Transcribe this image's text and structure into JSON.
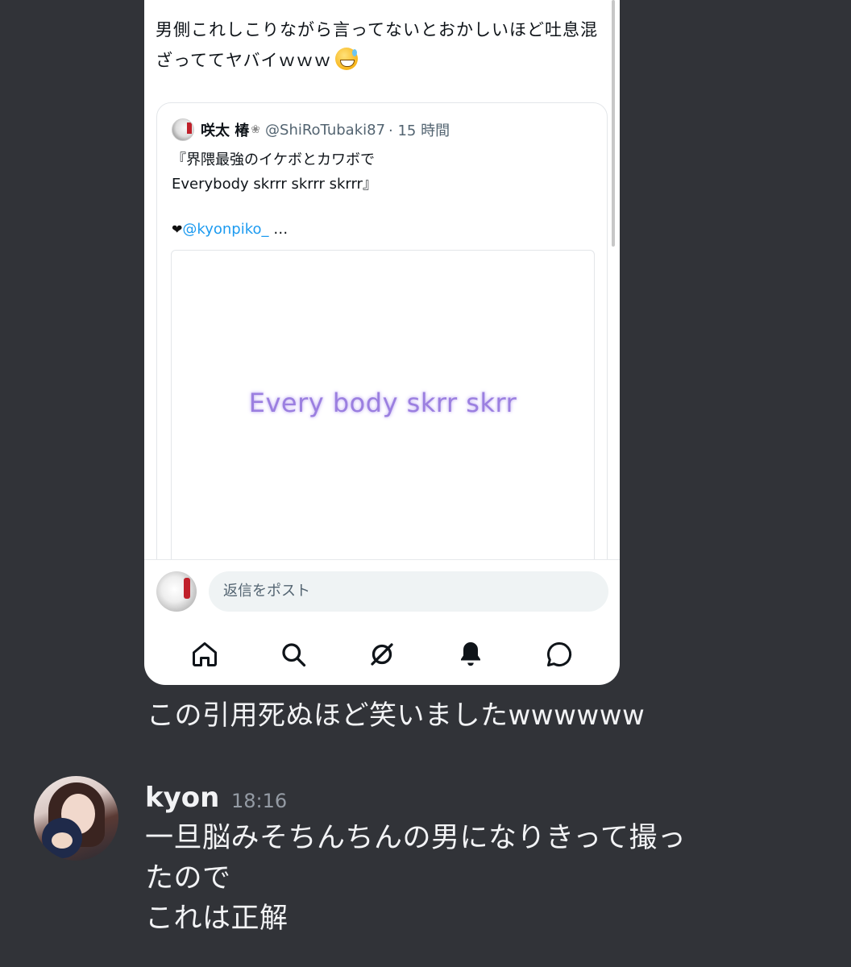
{
  "quoted_screenshot": {
    "tweet_text": "男側これしこりながら言ってないとおかしいほど吐息混ざっててヤバイｗｗｗ",
    "tweet_emoji": "sweat-smile-emoji",
    "quote": {
      "author_name": "咲太 椿",
      "author_flower": "❀",
      "author_handle": "@ShiRoTubaki87",
      "time": "· 15 時間",
      "body": "『界隈最強のイケボとカワボで\nEverybody skrrr skrrr skrrr』",
      "mention": "@kyonpiko_",
      "mention_suffix": " …",
      "media_caption": "Every body skrr skrr"
    },
    "reply_placeholder": "返信をポスト",
    "tabs": [
      "home-icon",
      "search-icon",
      "grok-icon",
      "notifications-icon",
      "messages-icon"
    ]
  },
  "chat": {
    "continued_message": "この引用死ぬほど笑いましたwwwwww",
    "message": {
      "author": "kyon",
      "time": "18:16",
      "lines": [
        "一旦脳みそちんちんの男になりきって撮っ",
        "たので",
        "これは正解"
      ]
    }
  }
}
